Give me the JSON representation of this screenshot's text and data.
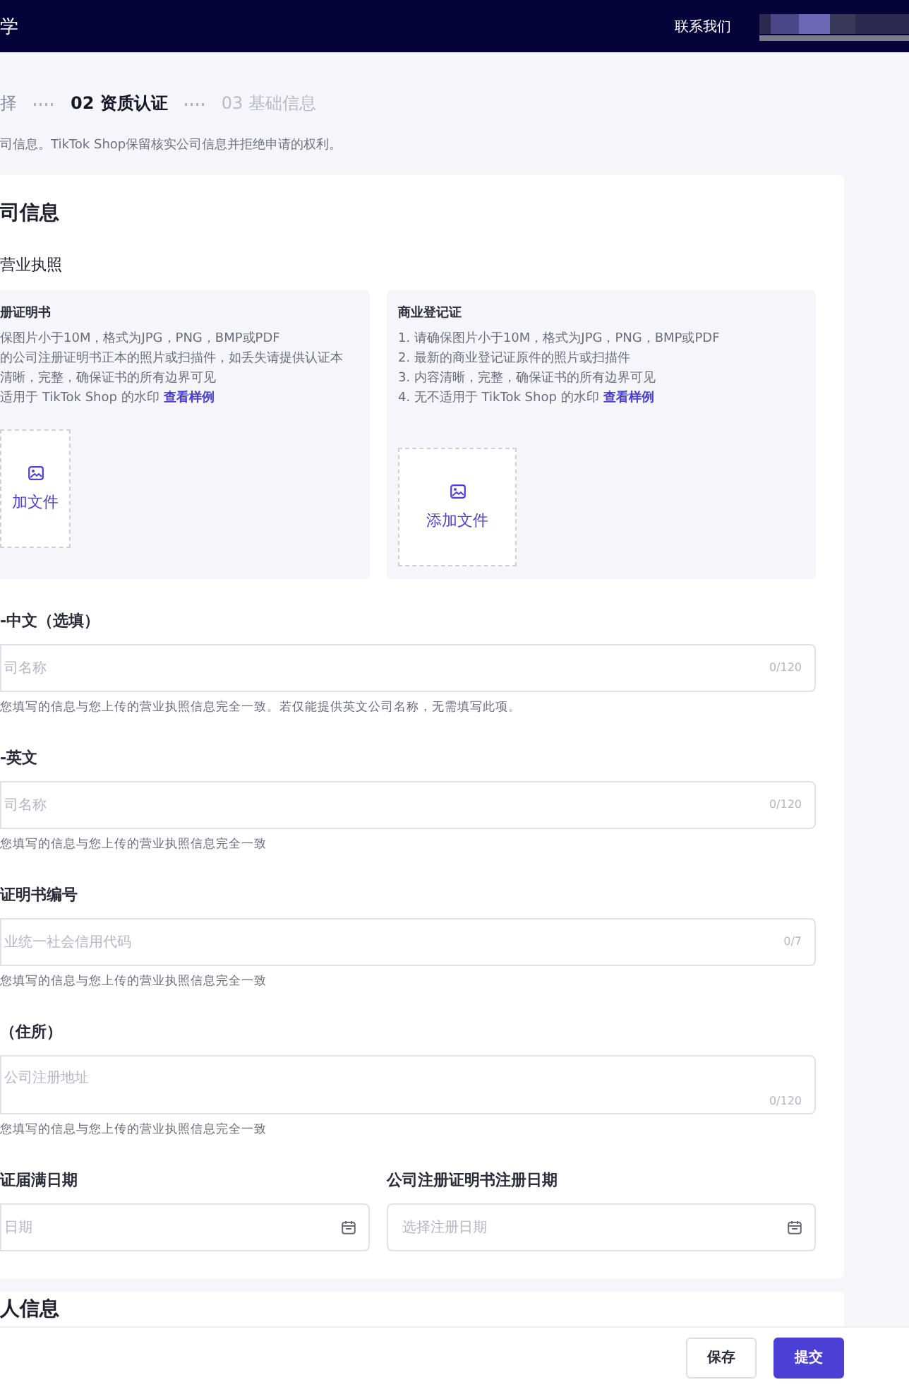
{
  "header": {
    "title": "学",
    "contact": "联系我们"
  },
  "steps": [
    {
      "label": "择",
      "selected": false,
      "completed": true
    },
    {
      "label": "02 资质认证",
      "selected": true,
      "completed": false
    },
    {
      "label": "03 基础信息",
      "selected": false,
      "completed": false
    }
  ],
  "notice": "司信息。TikTok Shop保留核实公司信息并拒绝申请的权利。",
  "card": {
    "title": "司信息",
    "subtitle": "营业执照",
    "uploads": [
      {
        "title": "册证明书",
        "items": [
          "保图片小于10M，格式为JPG，PNG，BMP或PDF",
          "的公司注册证明书正本的照片或扫描件，如丢失请提供认证本",
          "清晰，完整，确保证书的所有边界可见",
          "适用于 TikTok Shop 的水印"
        ],
        "link": "查看样例",
        "button": "加文件"
      },
      {
        "title": "商业登记证",
        "items": [
          "1. 请确保图片小于10M，格式为JPG，PNG，BMP或PDF",
          "2. 最新的商业登记证原件的照片或扫描件",
          "3. 内容清晰，完整，确保证书的所有边界可见",
          "4. 无不适用于 TikTok Shop 的水印"
        ],
        "link": "查看样例",
        "button": "添加文件"
      }
    ],
    "fields": [
      {
        "kind": "input",
        "label": "-中文（选填）",
        "placeholder": "司名称",
        "counter": "0/120",
        "helper": "您填写的信息与您上传的营业执照信息完全一致。若仅能提供英文公司名称，无需填写此项。"
      },
      {
        "kind": "input",
        "label": "-英文",
        "placeholder": "司名称",
        "counter": "0/120",
        "helper": "您填写的信息与您上传的营业执照信息完全一致"
      },
      {
        "kind": "input",
        "label": "证明书编号",
        "placeholder": "业统一社会信用代码",
        "counter": "0/7",
        "helper": "您填写的信息与您上传的营业执照信息完全一致"
      },
      {
        "kind": "textarea",
        "label": "（住所）",
        "placeholder": "公司注册地址",
        "counter": "0/120",
        "helper": "您填写的信息与您上传的营业执照信息完全一致"
      }
    ],
    "dates": [
      {
        "label": "证届满日期",
        "placeholder": "日期"
      },
      {
        "label": "公司注册证明书注册日期",
        "placeholder": "选择注册日期"
      }
    ]
  },
  "next_card": {
    "title": "人信息"
  },
  "footer": {
    "buttons": [
      {
        "label": "保存",
        "kind": "secondary"
      },
      {
        "label": "提交",
        "kind": "primary"
      }
    ]
  }
}
